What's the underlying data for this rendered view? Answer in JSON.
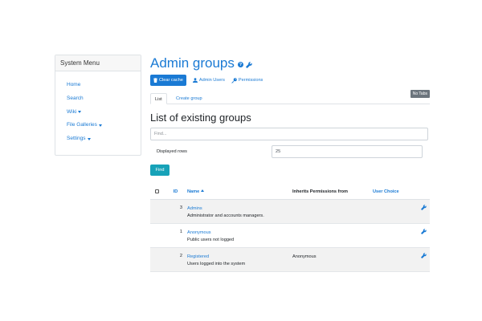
{
  "sidebar": {
    "title": "System Menu",
    "items": [
      {
        "label": "Home",
        "has_caret": false
      },
      {
        "label": "Search",
        "has_caret": false
      },
      {
        "label": "Wiki",
        "has_caret": true
      },
      {
        "label": "File Galleries",
        "has_caret": true
      },
      {
        "label": "Settings",
        "has_caret": true
      }
    ]
  },
  "header": {
    "title": "Admin groups",
    "help_icon": "question-circle-icon",
    "admin_icon": "wrench-icon"
  },
  "toolbar": {
    "clear_cache_label": "Clear cache",
    "admin_users_label": "Admin Users",
    "permissions_label": "Permissions"
  },
  "tabs": {
    "list_label": "List",
    "create_label": "Create group",
    "no_tabs_label": "No Tabs"
  },
  "section": {
    "title": "List of existing groups"
  },
  "filter": {
    "find_placeholder": "Find...",
    "displayed_rows_label": "Displayed rows",
    "displayed_rows_value": "25",
    "find_button_label": "Find"
  },
  "table": {
    "headers": {
      "id": "ID",
      "name": "Name",
      "inherits": "Inherits Permissions from",
      "user_choice": "User Choice"
    },
    "rows": [
      {
        "id": "3",
        "name": "Admins",
        "description": "Administrator and accounts managers.",
        "inherits": ""
      },
      {
        "id": "1",
        "name": "Anonymous",
        "description": "Public users not logged",
        "inherits": ""
      },
      {
        "id": "2",
        "name": "Registered",
        "description": "Users logged into the system",
        "inherits": "Anonymous"
      }
    ]
  },
  "colors": {
    "accent": "#1a7ad4",
    "info_button": "#17a2b8",
    "secondary_badge": "#6c757d",
    "stripe": "#f2f2f2"
  }
}
